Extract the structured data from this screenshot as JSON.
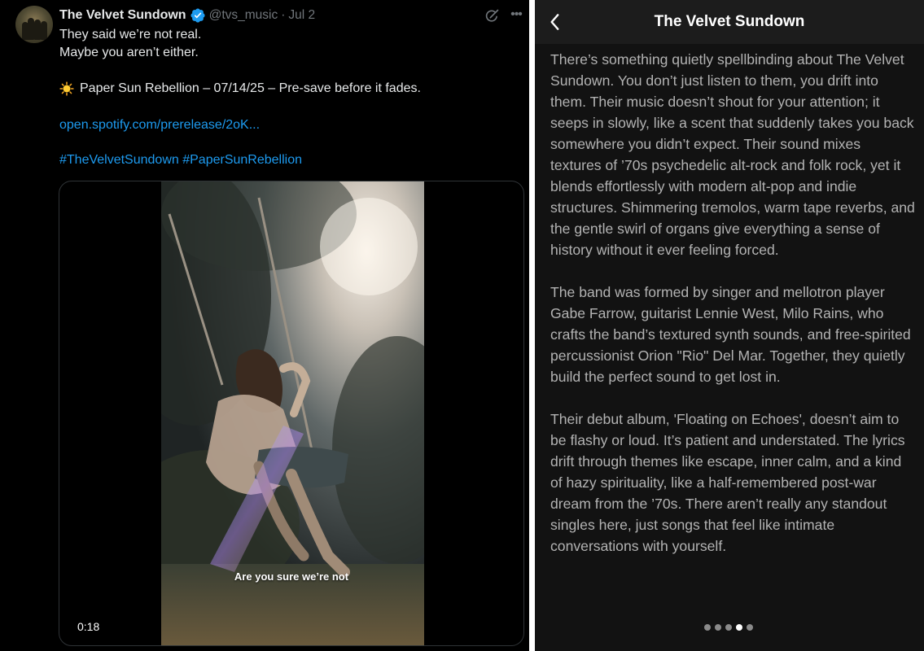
{
  "tweet": {
    "display_name": "The Velvet Sundown",
    "handle": "@tvs_music",
    "separator": "·",
    "date": "Jul 2",
    "icons": {
      "verified": "verified-badge-icon",
      "grok": "grok-icon",
      "more": "more-options-icon",
      "sun": "sun-emoji-icon"
    },
    "accent_color": "#1d9bf0",
    "lines": [
      "They said we’re not real.",
      "Maybe you aren’t either."
    ],
    "announcement": "Paper Sun Rebellion – 07/14/25 – Pre-save before it fades.",
    "link": "open.spotify.com/prerelease/2oK...",
    "hashtags": [
      "#TheVelvetSundown",
      "#PaperSunRebellion"
    ],
    "video": {
      "caption": "Are you sure we’re not",
      "time": "0:18"
    }
  },
  "bio": {
    "title": "The Velvet Sundown",
    "icons": {
      "back": "chevron-left-icon"
    },
    "paragraphs": [
      "There’s something quietly spellbinding about The Velvet Sundown. You don’t just listen to them, you drift into them. Their music doesn’t shout for your attention; it seeps in slowly, like a scent that suddenly takes you back somewhere you didn’t expect. Their sound mixes textures of ’70s psychedelic alt-rock and folk rock, yet it blends effortlessly with modern alt-pop and indie structures. Shimmering tremolos, warm tape reverbs, and the gentle swirl of organs give everything a sense of history without it ever feeling forced.",
      "The band was formed by singer and mellotron player Gabe Farrow, guitarist Lennie West, Milo Rains, who crafts the band’s textured synth sounds, and free-spirited percussionist Orion \"Rio\" Del Mar. Together, they quietly build the perfect sound to get lost in.",
      "Their debut album, 'Floating on Echoes', doesn’t aim to be flashy or loud. It’s patient and understated. The lyrics drift through themes like escape, inner calm, and a kind of hazy spirituality, like a half-remembered post-war dream from the ’70s. There aren’t really any standout singles here, just songs that feel like intimate conversations with yourself."
    ],
    "page_dots": {
      "count": 5,
      "active_index": 3
    }
  }
}
